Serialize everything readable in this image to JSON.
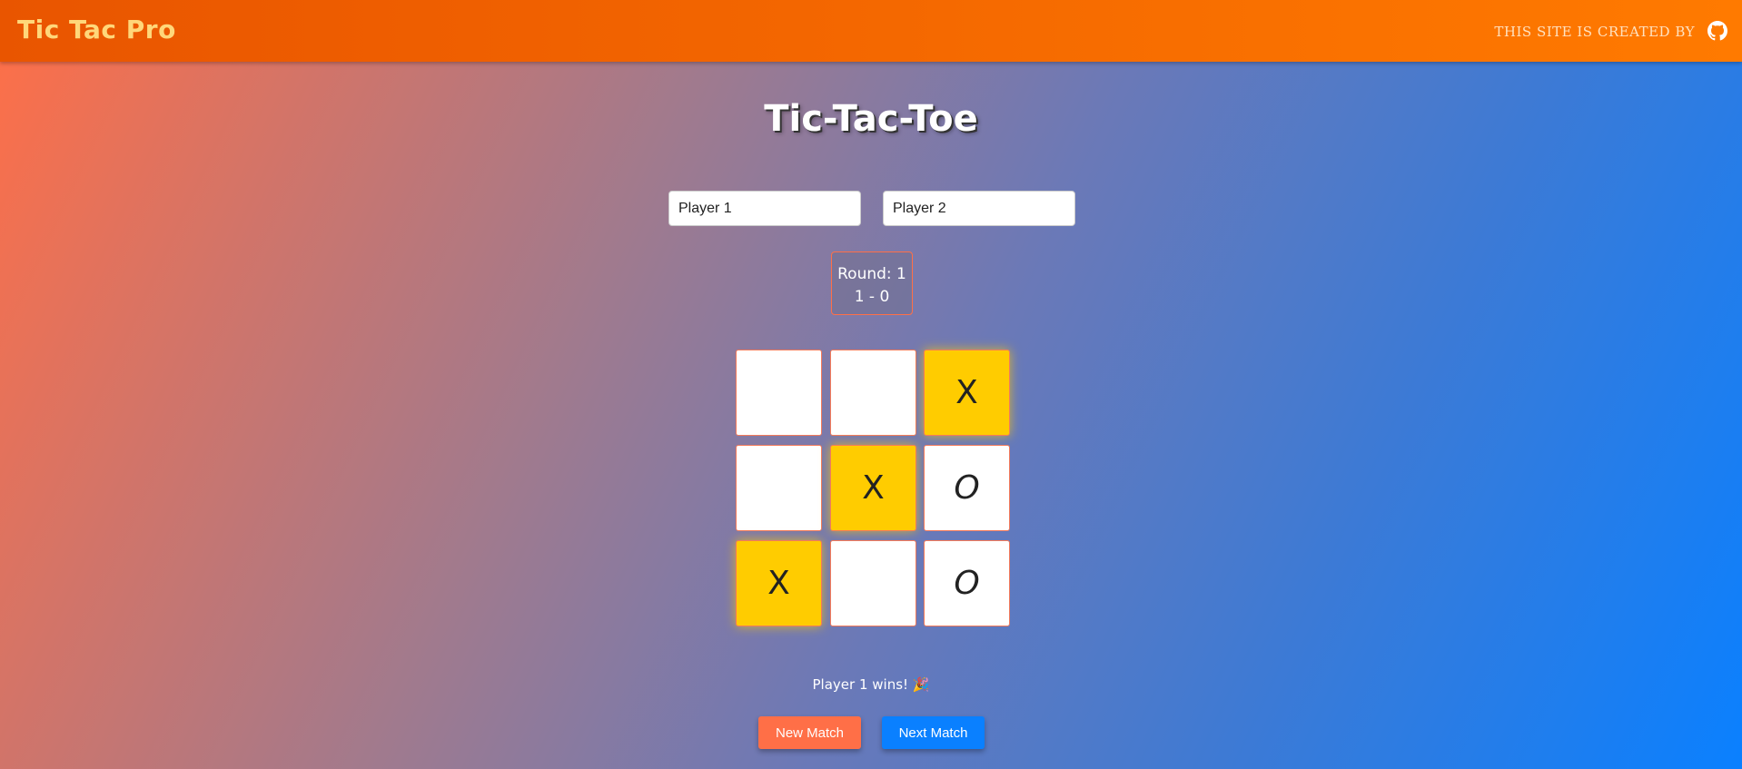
{
  "navbar": {
    "brand": "Tic Tac Pro",
    "credit": "THIS SITE IS CREATED BY",
    "icon": "github-icon"
  },
  "game": {
    "title": "Tic-Tac-Toe",
    "player1_value": "Player 1",
    "player2_value": "Player 2",
    "round_text": "Round: 1",
    "score_text": "1 - 0",
    "board": [
      [
        "",
        "",
        "X"
      ],
      [
        "",
        "X",
        "O"
      ],
      [
        "X",
        "",
        "O"
      ]
    ],
    "winning_cells": [
      [
        0,
        2
      ],
      [
        1,
        1
      ],
      [
        2,
        0
      ]
    ],
    "message": "Player 1 wins! 🎉"
  },
  "buttons": {
    "new_match": "New Match",
    "next_match": "Next Match"
  },
  "colors": {
    "accent_orange": "#ff6f47",
    "accent_blue": "#0a80ff",
    "win_cell": "#ffcc00"
  }
}
